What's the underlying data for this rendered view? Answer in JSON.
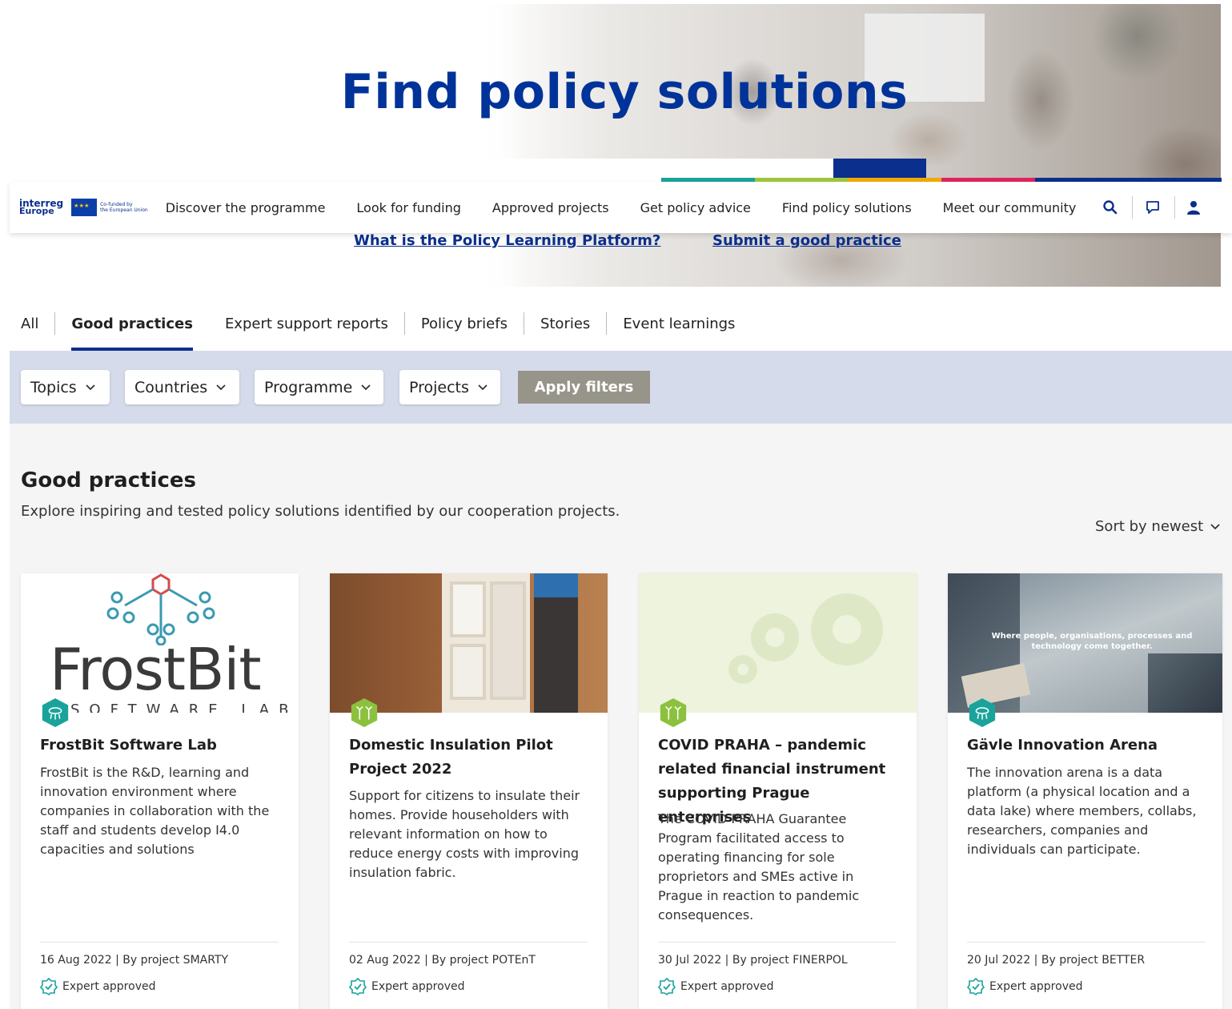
{
  "hero": {
    "title": "Find policy solutions",
    "links": [
      "What is the Policy Learning Platform?",
      "Submit a good practice"
    ]
  },
  "brand": {
    "logo_line1": "interreg",
    "logo_line2": "Europe",
    "cofunded_line1": "Co-funded by",
    "cofunded_line2": "the European Union",
    "primary_color": "#003399",
    "accent_colors": [
      "#1aa39a",
      "#9ec63a",
      "#f2a900",
      "#e0235e",
      "#0b2f8c"
    ]
  },
  "nav": {
    "items": [
      "Discover the programme",
      "Look for funding",
      "Approved projects",
      "Get policy advice",
      "Find policy solutions",
      "Meet our community"
    ],
    "icons": [
      "search-icon",
      "chat-icon",
      "user-icon"
    ]
  },
  "tabs": {
    "items": [
      "All",
      "Good practices",
      "Expert support reports",
      "Policy briefs",
      "Stories",
      "Event learnings"
    ],
    "active": "Good practices"
  },
  "filters": {
    "items": [
      "Topics",
      "Countries",
      "Programme",
      "Projects"
    ],
    "apply_label": "Apply filters"
  },
  "section": {
    "title": "Good practices",
    "subtitle": "Explore inspiring and tested policy solutions identified by our cooperation projects.",
    "sort_label": "Sort by newest"
  },
  "cards": [
    {
      "title": "FrostBit Software Lab",
      "description": "FrostBit is the R&D, learning and innovation environment where companies in collaboration with the staff and students develop I4.0 capacities and solutions",
      "meta": "16 Aug 2022 | By project SMARTY",
      "approved": "Expert approved",
      "badge_color": "#1aa39a",
      "image_text": "FrostBit",
      "image_subtext": "SOFTWARE LAB"
    },
    {
      "title": "Domestic Insulation Pilot Project 2022",
      "description": "Support for citizens to insulate their homes. Provide householders with relevant information on how to reduce energy costs with improving insulation fabric.",
      "meta": "02 Aug 2022 | By project POTEnT",
      "approved": "Expert approved",
      "badge_color": "#8cc13f"
    },
    {
      "title": "COVID PRAHA – pandemic related financial instrument supporting Prague enterprises",
      "description": "The COVID PRAHA Guarantee Program facilitated access to operating financing for sole proprietors and SMEs active in Prague in reaction to pandemic consequences.",
      "meta": "30 Jul 2022 | By project FINERPOL",
      "approved": "Expert approved",
      "badge_color": "#8cc13f"
    },
    {
      "title": "Gävle Innovation Arena",
      "description": "The innovation arena is a data platform (a physical location and a data lake) where members, collabs, researchers, companies and individuals can participate.",
      "meta": "20 Jul 2022 | By project BETTER",
      "approved": "Expert approved",
      "badge_color": "#1aa39a",
      "image_text": "Where people, organisations, processes and technology come together."
    }
  ]
}
